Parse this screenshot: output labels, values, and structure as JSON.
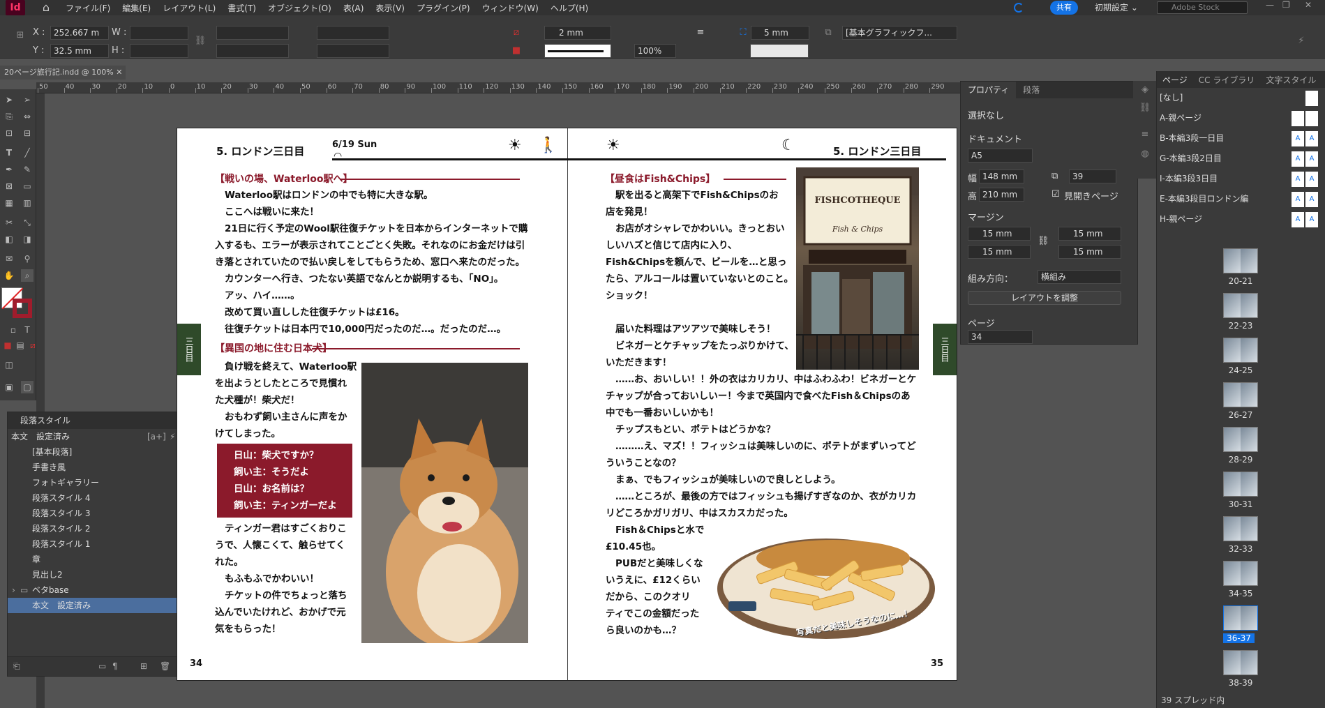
{
  "app": {
    "logo": "Id",
    "menu": [
      "ファイル(F)",
      "編集(E)",
      "レイアウト(L)",
      "書式(T)",
      "オブジェクト(O)",
      "表(A)",
      "表示(V)",
      "プラグイン(P)",
      "ウィンドウ(W)",
      "ヘルプ(H)"
    ],
    "share_label": "共有",
    "workspace_label": "初期設定",
    "stock_placeholder": "Adobe Stock"
  },
  "control": {
    "x_label": "X :",
    "x_value": "252.667 m",
    "y_label": "Y :",
    "y_value": "32.5 mm",
    "w_label": "W :",
    "h_label": "H :",
    "stroke_weight": "2 mm",
    "scale": "100%",
    "corner": "5 mm",
    "style_field": "[基本グラフィックフ..."
  },
  "document": {
    "tab_label": "20ページ旅行記.indd @ 100%"
  },
  "ruler": {
    "labels": [
      "50",
      "40",
      "30",
      "20",
      "10",
      "0",
      "10",
      "20",
      "30",
      "40",
      "50",
      "60",
      "70",
      "80",
      "90",
      "100",
      "110",
      "120",
      "130",
      "140",
      "150",
      "160",
      "170",
      "180",
      "190",
      "200",
      "210",
      "220",
      "230",
      "240",
      "250",
      "260",
      "270",
      "280",
      "290"
    ]
  },
  "paragraph_styles": {
    "title": "段落スタイル",
    "current": "本文　設定済み",
    "items": [
      {
        "label": "[基本段落]"
      },
      {
        "label": "手書き風"
      },
      {
        "label": "フォトギャラリー"
      },
      {
        "label": "段落スタイル 4"
      },
      {
        "label": "段落スタイル 3"
      },
      {
        "label": "段落スタイル 2"
      },
      {
        "label": "段落スタイル 1"
      },
      {
        "label": "章"
      },
      {
        "label": "見出し2"
      },
      {
        "label": "ベタbase"
      },
      {
        "label": "本文　設定済み"
      }
    ]
  },
  "spread": {
    "left": {
      "run_title": "5. ロンドン三日目",
      "date": "6/19 Sun",
      "side_tab": "三日目",
      "section1_heading": "【戦いの場、Waterloo駅へ】",
      "section1_lines": [
        "Waterloo駅はロンドンの中でも特に大きな駅。",
        "ここへは戦いに来た！",
        "21日に行く予定のWool駅往復チケットを日本からインターネットで購",
        "入するも、エラーが表示されてことごとく失敗。それなのにお金だけは引",
        "き落とされていたので払い戻しをしてもらうため、窓口へ来たのだった。",
        "カウンターへ行き、つたない英語でなんとか説明するも、「NO」。",
        "アッ、ハイ……。",
        "改めて買い直しした往復チケットは£16。",
        "往復チケットは日本円で10,000円だったのだ…。だったのだ…。"
      ],
      "section2_heading": "【異国の地に住む日本犬】",
      "section2_lines": [
        "負け戦を終えて、Waterloo駅",
        "を出ようとしたところで見慣れ",
        "た犬種が！柴犬だ！",
        "おもわず飼い主さんに声をか",
        "けてしまった。"
      ],
      "dialog_lines": [
        "日山：柴犬ですか？",
        "飼い主：そうだよ",
        "日山：お名前は？",
        "飼い主：ティンガーだよ"
      ],
      "section2_after": [
        "ティンガー君はすごくおりこ",
        "うで、人懐こくて、触らせてく",
        "れた。",
        "もふもふでかわいい！",
        "チケットの件でちょっと落ち",
        "込んでいたけれど、おかげで元",
        "気をもらった！"
      ],
      "page_number": "34"
    },
    "right": {
      "run_title": "5. ロンドン三日目",
      "side_tab": "三日目",
      "section_heading": "【昼食はFish&Chips】",
      "lines_top": [
        "駅を出ると高架下でFish&Chipsのお",
        "店を発見！",
        "お店がオシャレでかわいい。きっとおい",
        "しいハズと信じて店内に入り、",
        "Fish&Chipsを頼んで、ビールを…と思っ",
        "たら、アルコールは置いていないとのこと。",
        "ショック！"
      ],
      "lines_mid": [
        "届いた料理はアツアツで美味しそう！",
        "ビネガーとケチャップをたっぷりかけて、",
        "いただきます！",
        "……お、おいしい！！外の衣はカリカリ、中はふわふわ！ビネガーとケ",
        "チャップが合っておいしいー！今まで英国内で食べたFish＆Chipsのあ",
        "中でも一番おいしいかも！",
        "チップスもとい、ポテトはどうかな？",
        "………え、マズ！！フィッシュは美味しいのに、ポテトがまずいってど",
        "ういうことなの？",
        "まぁ、でもフィッシュが美味しいので良しとしよう。",
        "……ところが、最後の方ではフィッシュも揚げすぎなのか、衣がカリカ",
        "リどころかガリガリ、中はスカスカだった。"
      ],
      "lines_bottom": [
        "Fish＆Chipsと水で",
        "£10.45也。",
        "PUBだと美味しくな",
        "いうえに、£12くらい",
        "だから、このクオリ",
        "ティでこの金額だった",
        "ら良いのかも…？"
      ],
      "shop_sign": "FISHCOTHEQUE",
      "shop_sub": "Fish & Chips",
      "handwritten_caption": "写真だと美味しそうなのに…！",
      "page_number": "35"
    }
  },
  "properties": {
    "tabs": [
      "プロパティ",
      "段落"
    ],
    "no_selection": "選択なし",
    "document_label": "ドキュメント",
    "page_size": "A5",
    "width_label": "幅",
    "width_value": "148 mm",
    "height_label": "高",
    "height_value": "210 mm",
    "pages_value": "39",
    "facing_pages": "見開きページ",
    "margin_label": "マージン",
    "margin_top": "15 mm",
    "margin_bottom": "15 mm",
    "margin_left": "15 mm",
    "margin_right": "15 mm",
    "direction_label": "組み方向：",
    "direction_value": "横組み",
    "adjust_layout": "レイアウトを調整",
    "page_label": "ページ",
    "page_value": "34"
  },
  "pages_panel": {
    "tabs": [
      "ページ",
      "CC ライブラリ",
      "文字スタイル"
    ],
    "masters": [
      "[なし]",
      "A-親ページ",
      "B-本編3段一日目",
      "G-本編3段2日目",
      "I-本編3段3日目",
      "E-本編3段目ロンドン編",
      "H-親ページ"
    ],
    "spreads": [
      {
        "label": "20-21",
        "letters": [
          "E",
          "D"
        ]
      },
      {
        "label": "22-23",
        "letters": [
          "G",
          "G"
        ]
      },
      {
        "label": "24-25",
        "letters": [
          "G",
          "G"
        ]
      },
      {
        "label": "26-27",
        "letters": [
          "G",
          "G"
        ]
      },
      {
        "label": "28-29",
        "letters": [
          "G",
          ""
        ]
      },
      {
        "label": "30-31",
        "letters": [
          "E",
          "D"
        ]
      },
      {
        "label": "32-33",
        "letters": [
          "I",
          "I"
        ]
      },
      {
        "label": "34-35",
        "letters": [
          "I",
          ""
        ]
      },
      {
        "label": "36-37",
        "letters": [
          "I",
          "I"
        ]
      },
      {
        "label": "38-39",
        "letters": [
          "I",
          "I"
        ]
      }
    ],
    "selected": "36-37",
    "footer": "39 スプレッド内"
  }
}
